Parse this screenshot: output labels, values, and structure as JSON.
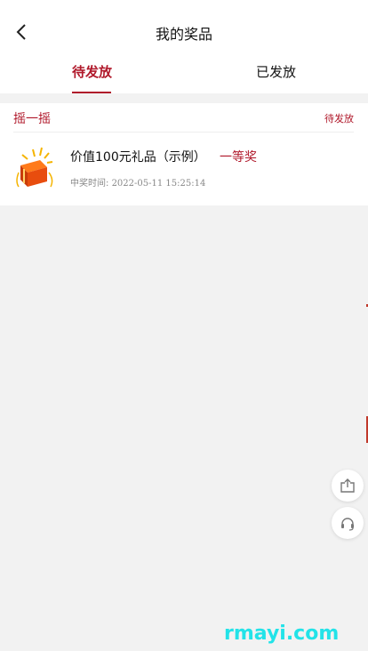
{
  "header": {
    "title": "我的奖品"
  },
  "tabs": [
    {
      "label": "待发放",
      "active": true
    },
    {
      "label": "已发放",
      "active": false
    }
  ],
  "prize_card": {
    "source": "摇一摇",
    "status": "待发放",
    "name": "价值100元礼品（示例）",
    "level": "一等奖",
    "time_label": "中奖时间:",
    "time_value": "2022-05-11 15:25:14"
  },
  "floating_buttons": [
    {
      "icon": "share-icon"
    },
    {
      "icon": "headset-icon"
    }
  ],
  "watermark": "rmayi.com",
  "colors": {
    "accent": "#b0192b",
    "background": "#f2f2f2",
    "watermark": "#22e3e8"
  }
}
